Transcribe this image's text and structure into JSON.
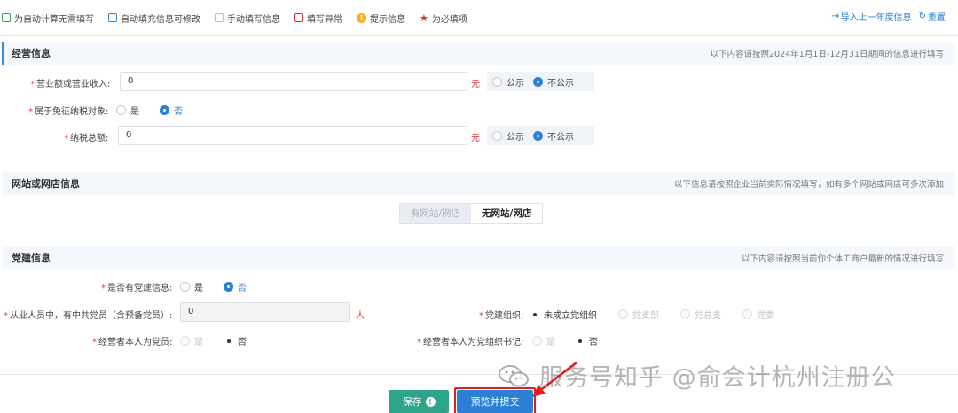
{
  "legend": {
    "items": [
      {
        "color": "#3aa55a",
        "label": "为自动计算无需填写"
      },
      {
        "color": "#2b8cd6",
        "label": "自动填充信息可修改"
      },
      {
        "color": "#bbbbbb",
        "label": "手动填写信息"
      },
      {
        "color": "#d43030",
        "label": "填写异常"
      }
    ],
    "tip_label": "提示信息",
    "required_label": "为必填项"
  },
  "top_links": {
    "import_label": "导入上一年度信息",
    "reset_label": "重置"
  },
  "business": {
    "title": "经营信息",
    "note": "以下内容请按照2024年1月1日-12月31日期间的信息进行填写",
    "revenue": {
      "label": "营业额或营业收入:",
      "value": "0",
      "unit": "元",
      "public_label": "公示",
      "private_label": "不公示",
      "selected": "不公示"
    },
    "tax_exempt": {
      "label": "属于免征纳税对象:",
      "yes_label": "是",
      "no_label": "否",
      "selected": "否"
    },
    "tax_total": {
      "label": "纳税总额:",
      "value": "0",
      "unit": "元",
      "public_label": "公示",
      "private_label": "不公示",
      "selected": "不公示"
    }
  },
  "website": {
    "title": "网站或网店信息",
    "note": "以下信息请按照企业当前实际情况填写，如有多个网站或网店可多次添加",
    "has_label": "有网站/网店",
    "none_label": "无网站/网店",
    "selected": "无网站/网店"
  },
  "party": {
    "title": "党建信息",
    "note": "以下内容请按照当前你个体工商户最新的情况进行填写",
    "has_party": {
      "label": "是否有党建信息:",
      "yes_label": "是",
      "no_label": "否",
      "selected": "否"
    },
    "members": {
      "label": "从业人员中，有中共党员（含预备党员）:",
      "value": "0",
      "unit": "人"
    },
    "org": {
      "label": "党建组织:",
      "options": [
        "未成立党组织",
        "党支部",
        "党总支",
        "党委"
      ],
      "selected": "未成立党组织"
    },
    "operator_member": {
      "label": "经营者本人为党员:",
      "yes_label": "是",
      "no_label": "否",
      "selected": "否"
    },
    "operator_secretary": {
      "label": "经营者本人为党组织书记:",
      "yes_label": "是",
      "no_label": "否",
      "selected": "否"
    }
  },
  "footer": {
    "save_label": "保存",
    "submit_label": "预览并提交"
  },
  "watermark": {
    "text": "服务号知乎 @俞会计杭州注册公"
  },
  "colors": {
    "accent": "#2b7fd4",
    "save": "#2ea58b",
    "required": "#e23b3b",
    "highlight": "#e02020"
  }
}
